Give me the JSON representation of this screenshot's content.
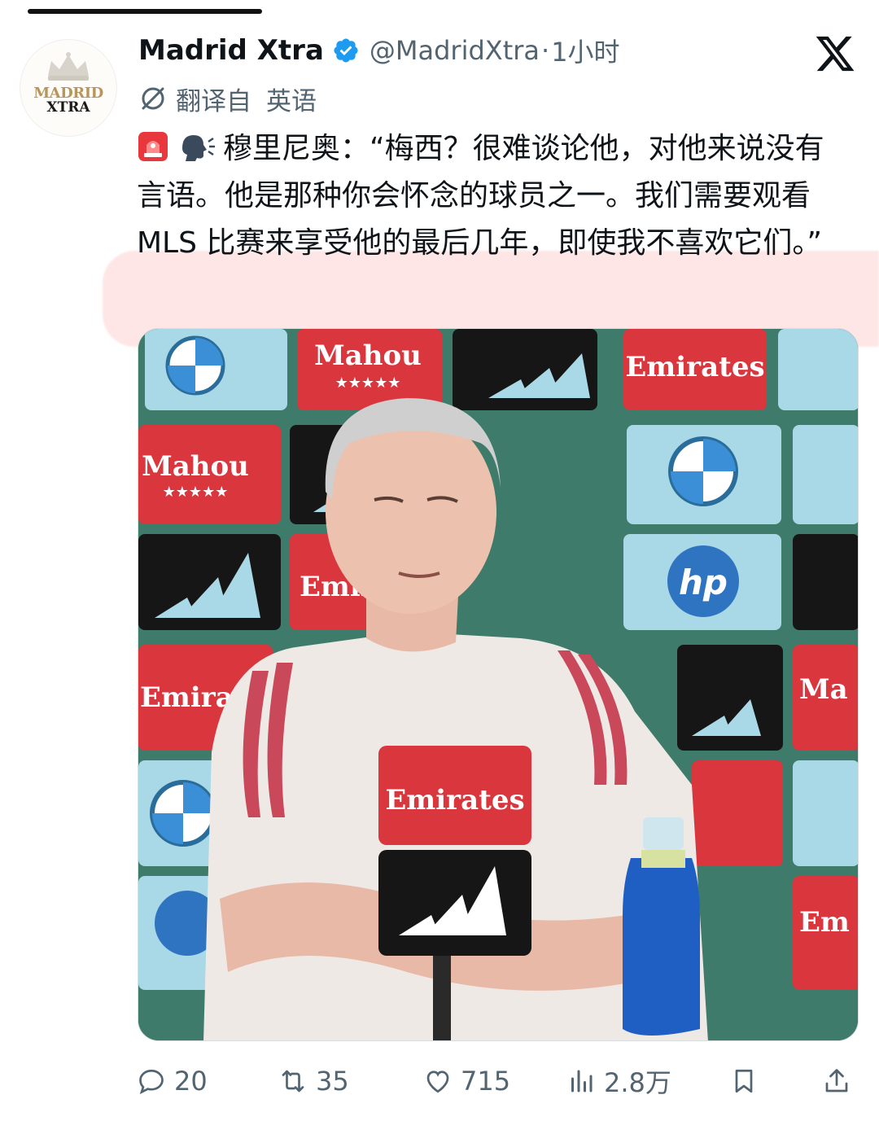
{
  "tweet": {
    "display_name": "Madrid Xtra",
    "handle": "@MadridXtra",
    "separator": "·",
    "time": "1小时",
    "translated_from_label": "翻译自",
    "translated_language": "英语",
    "text": "穆里尼奥：“梅西？很难谈论他，对他来说没有言语。他是那种你会怀念的球员之一。我们需要观看 MLS 比赛来享受他的最后几年，即使我不喜欢它们。”",
    "emojis": [
      "rotating-light-emoji",
      "speaking-head-emoji"
    ]
  },
  "avatar": {
    "logo_line1": "MADRID",
    "logo_line2": "XTRA"
  },
  "media": {
    "sponsor_boards": [
      "Mahou",
      "Emirates",
      "Emirates",
      "Mahou",
      "Emirat",
      "Emirate",
      "Emirates",
      "Em",
      "Ma"
    ],
    "desk_sign": "Emirates"
  },
  "actions": {
    "replies": "20",
    "reposts": "35",
    "likes": "715",
    "views": "2.8万"
  },
  "colors": {
    "verified": "#1d9bf0",
    "muted_text": "#536471",
    "highlight": "#fcd2d0",
    "emirates_red": "#d9363e",
    "board_green": "#3e7a6b"
  }
}
